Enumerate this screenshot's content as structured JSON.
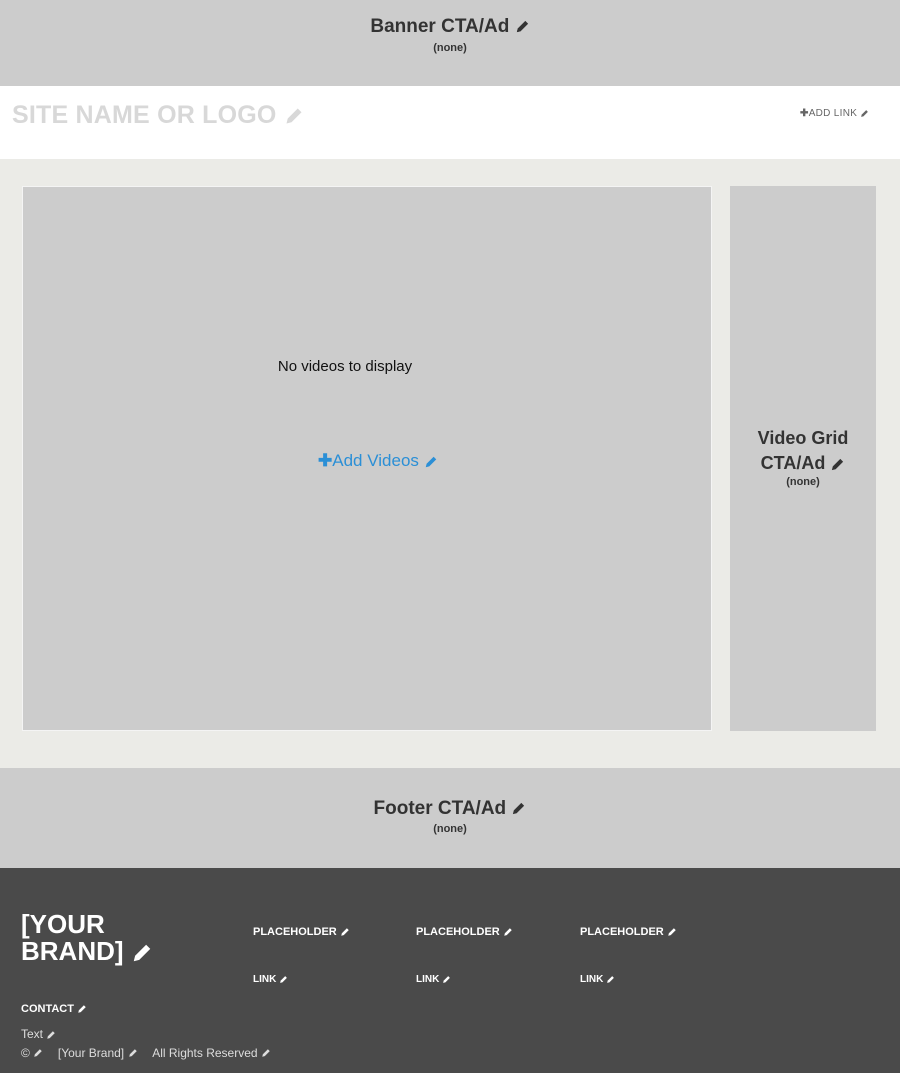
{
  "banner": {
    "title": "Banner CTA/Ad",
    "subtitle": "(none)"
  },
  "header": {
    "site_name": "SITE NAME OR LOGO",
    "add_link_label": "ADD LINK"
  },
  "main": {
    "empty_message": "No videos to display",
    "add_videos_label": "Add Videos"
  },
  "side_cta": {
    "title_line1": "Video Grid",
    "title_line2": "CTA/Ad",
    "subtitle": "(none)"
  },
  "footer_cta": {
    "title": "Footer CTA/Ad",
    "subtitle": "(none)"
  },
  "footer": {
    "brand_line1": "[YOUR",
    "brand_line2": "BRAND]",
    "columns": [
      {
        "heading": "PLACEHOLDER",
        "link": "LINK"
      },
      {
        "heading": "PLACEHOLDER",
        "link": "LINK"
      },
      {
        "heading": "PLACEHOLDER",
        "link": "LINK"
      }
    ],
    "contact_heading": "CONTACT",
    "contact_text": "Text",
    "copyright_symbol": "©",
    "copyright_brand": "[Your Brand]",
    "rights": "All Rights Reserved"
  },
  "colors": {
    "accent_link": "#2b8fd6",
    "cta_background": "#cccccc",
    "footer_background": "#4a4a4a",
    "page_background": "#ebebe7"
  },
  "icons": [
    "pencil-icon",
    "plus-icon"
  ]
}
